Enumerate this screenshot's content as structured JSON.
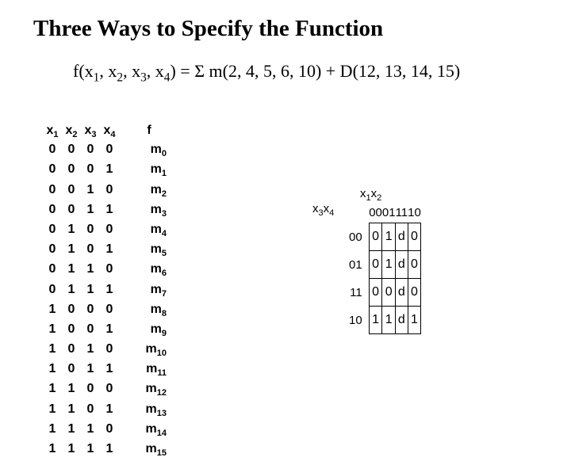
{
  "title_a": "Three Ways to Specify the Function",
  "eqn": {
    "lhs": "f(x",
    "s1": "1",
    "c1": ", x",
    "s2": "2",
    "c2": ", x",
    "s3": "3",
    "c3": ", x",
    "s4": "4",
    "rhs": ") = Σ m(2, 4, 5, 6, 10) + D(12, 13, 14, 15)"
  },
  "truth": {
    "hdr": {
      "v": [
        "x",
        "x",
        "x",
        "x"
      ],
      "vs": [
        "1",
        "2",
        "3",
        "4"
      ],
      "f": "f"
    },
    "rows": [
      {
        "b": [
          "0",
          "0",
          "0",
          "0"
        ],
        "m": "m",
        "ms": "0"
      },
      {
        "b": [
          "0",
          "0",
          "0",
          "1"
        ],
        "m": "m",
        "ms": "1"
      },
      {
        "b": [
          "0",
          "0",
          "1",
          "0"
        ],
        "m": "m",
        "ms": "2"
      },
      {
        "b": [
          "0",
          "0",
          "1",
          "1"
        ],
        "m": "m",
        "ms": "3"
      },
      {
        "b": [
          "0",
          "1",
          "0",
          "0"
        ],
        "m": "m",
        "ms": "4"
      },
      {
        "b": [
          "0",
          "1",
          "0",
          "1"
        ],
        "m": "m",
        "ms": "5"
      },
      {
        "b": [
          "0",
          "1",
          "1",
          "0"
        ],
        "m": "m",
        "ms": "6"
      },
      {
        "b": [
          "0",
          "1",
          "1",
          "1"
        ],
        "m": "m",
        "ms": "7"
      },
      {
        "b": [
          "1",
          "0",
          "0",
          "0"
        ],
        "m": "m",
        "ms": "8"
      },
      {
        "b": [
          "1",
          "0",
          "0",
          "1"
        ],
        "m": "m",
        "ms": "9"
      },
      {
        "b": [
          "1",
          "0",
          "1",
          "0"
        ],
        "m": "m",
        "ms": "10"
      },
      {
        "b": [
          "1",
          "0",
          "1",
          "1"
        ],
        "m": "m",
        "ms": "11"
      },
      {
        "b": [
          "1",
          "1",
          "0",
          "0"
        ],
        "m": "m",
        "ms": "12"
      },
      {
        "b": [
          "1",
          "1",
          "0",
          "1"
        ],
        "m": "m",
        "ms": "13"
      },
      {
        "b": [
          "1",
          "1",
          "1",
          "0"
        ],
        "m": "m",
        "ms": "14"
      },
      {
        "b": [
          "1",
          "1",
          "1",
          "1"
        ],
        "m": "m",
        "ms": "15"
      }
    ]
  },
  "kmap": {
    "top_v": "x",
    "top_s1": "1",
    "top_v2": "x",
    "top_s2": "2",
    "left_v": "x",
    "left_s1": "3",
    "left_v2": "x",
    "left_s2": "4",
    "cols": [
      "00",
      "01",
      "11",
      "10"
    ],
    "rows": [
      "00",
      "01",
      "11",
      "10"
    ],
    "cells": [
      [
        "0",
        "1",
        "d",
        "0"
      ],
      [
        "0",
        "1",
        "d",
        "0"
      ],
      [
        "0",
        "0",
        "d",
        "0"
      ],
      [
        "1",
        "1",
        "d",
        "1"
      ]
    ]
  },
  "chart_data": {
    "type": "table",
    "title": "Karnaugh map for f(x1,x2,x3,x4)=Σm(2,4,5,6,10)+D(12,13,14,15)",
    "col_var": "x1x2",
    "row_var": "x3x4",
    "columns": [
      "00",
      "01",
      "11",
      "10"
    ],
    "rows": [
      "00",
      "01",
      "11",
      "10"
    ],
    "values": [
      [
        "0",
        "1",
        "d",
        "0"
      ],
      [
        "0",
        "1",
        "d",
        "0"
      ],
      [
        "0",
        "0",
        "d",
        "0"
      ],
      [
        "1",
        "1",
        "d",
        "1"
      ]
    ]
  }
}
